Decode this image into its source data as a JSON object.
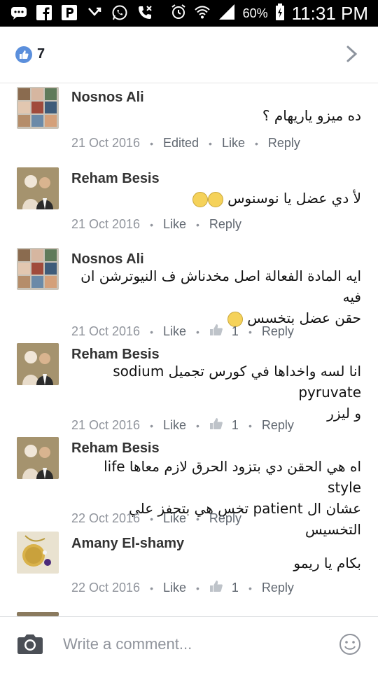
{
  "status_bar": {
    "icons_left": [
      "message-icon",
      "facebook-icon",
      "p-icon",
      "missed-call-icon",
      "whatsapp-icon",
      "phone-icon"
    ],
    "battery_percent": "60%",
    "time": "11:31 PM"
  },
  "likes": {
    "count": "7"
  },
  "comments": [
    {
      "author": "Nosnos Ali",
      "text": "ده ميزو ياريهام ؟",
      "date": "21 Oct 2016",
      "edited": "Edited",
      "like": "Like",
      "reply": "Reply"
    },
    {
      "author": "Reham Besis",
      "text": "لأ دي عضل  يا نوسنوس",
      "date": "21 Oct 2016",
      "like": "Like",
      "reply": "Reply"
    },
    {
      "author": "Nosnos Ali",
      "text_line1": "ايه المادة الفعالة اصل مخدناش ف النيوترشن ان فيه",
      "text_line2": "حقن عضل بتخسس",
      "date": "21 Oct 2016",
      "like": "Like",
      "like_count": "1",
      "reply": "Reply"
    },
    {
      "author": "Reham Besis",
      "text_line1": "انا لسه واخداها في كورس تجميل sodium pyruvate",
      "text_line2": "و ليزر",
      "date": "21 Oct 2016",
      "like": "Like",
      "like_count": "1",
      "reply": "Reply"
    },
    {
      "author": "Reham Besis",
      "text_line1": "اه هي الحقن دي  بتزود الحرق لازم معاها  life style",
      "text_line2": "عشان ال patient  تخس  هي بتحفز علي التخسيس",
      "date": "22 Oct 2016",
      "like": "Like",
      "reply": "Reply"
    },
    {
      "author": "Amany El-shamy",
      "text": "بكام يا ريمو",
      "date": "22 Oct 2016",
      "like": "Like",
      "like_count": "1",
      "reply": "Reply"
    }
  ],
  "composer": {
    "placeholder": "Write a comment..."
  },
  "colors": {
    "like_blue": "#5b8fdc",
    "meta_gray": "#90949c"
  }
}
